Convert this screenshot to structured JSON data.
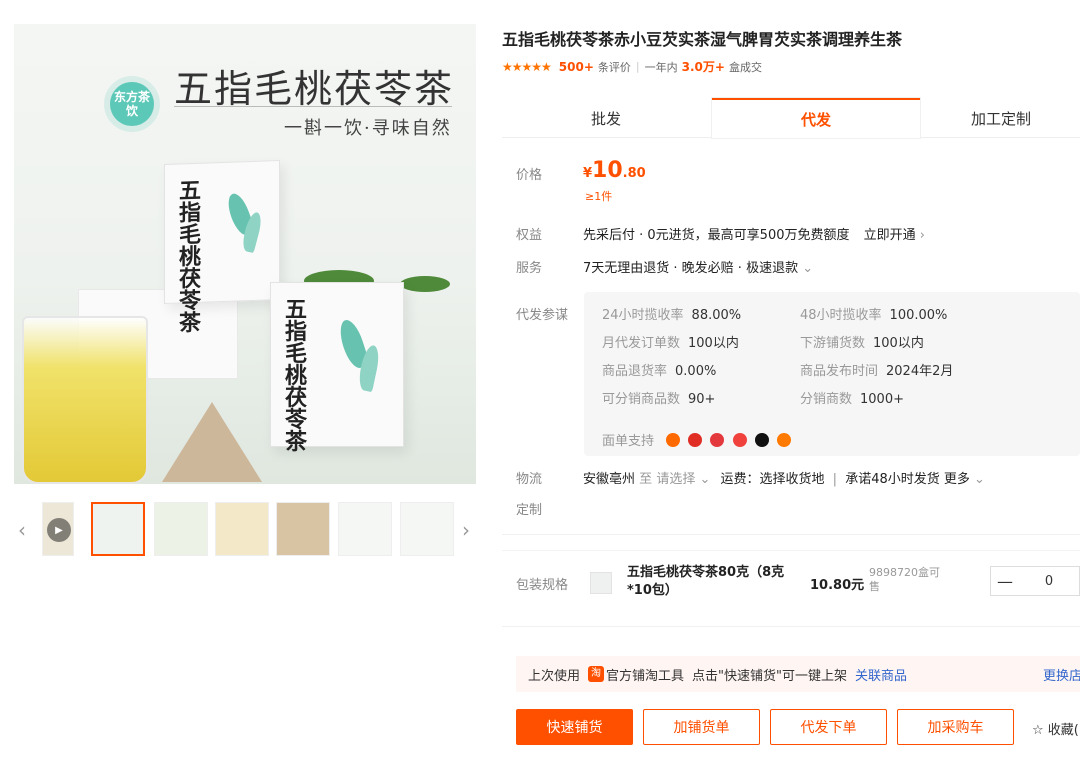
{
  "gallery": {
    "hero_title": "五指毛桃茯苓茶",
    "hero_subtitle": "一斟一饮·寻味自然",
    "logo_text": "东方茶饮",
    "box1_text": "五指毛桃茯苓茶",
    "box2_text": "五指毛桃茯苓茶",
    "prev_arrow": "‹",
    "next_arrow": "›"
  },
  "product": {
    "title": "五指毛桃茯苓茶赤小豆芡实茶湿气脾胃芡实茶调理养生茶",
    "stars": "★★★★★",
    "reviews_count": "500+",
    "reviews_label": "条评价",
    "sales_period": "一年内",
    "sales_count": "3.0万+",
    "sales_unit": "盒成交"
  },
  "tabs": [
    "批发",
    "代发",
    "加工定制"
  ],
  "price": {
    "label": "价格",
    "yen": "¥",
    "integer": "10",
    "decimal": ".80",
    "moq": "≥1件"
  },
  "rights": {
    "label": "权益",
    "text": "先采后付 · 0元进货，最高可享500万免费额度",
    "link": "立即开通"
  },
  "service": {
    "label": "服务",
    "text": "7天无理由退货 · 晚发必赔 · 极速退款"
  },
  "dropship": {
    "label": "代发参谋",
    "metrics": [
      {
        "k": "24小时揽收率",
        "v": "88.00%"
      },
      {
        "k": "48小时揽收率",
        "v": "100.00%"
      },
      {
        "k": "月代发订单数",
        "v": "100以内"
      },
      {
        "k": "下游铺货数",
        "v": "100以内"
      },
      {
        "k": "商品退货率",
        "v": "0.00%"
      },
      {
        "k": "商品发布时间",
        "v": "2024年2月"
      },
      {
        "k": "可分销商品数",
        "v": "90+"
      },
      {
        "k": "分销商数",
        "v": "1000+"
      }
    ],
    "support_label": "面单支持"
  },
  "logistics": {
    "label": "物流",
    "origin": "安徽亳州",
    "to": "至",
    "select_text": "请选择",
    "fee_text": "运费：选择收货地",
    "promise": "承诺48小时发货",
    "more": "更多"
  },
  "custom": {
    "label": "定制"
  },
  "package": {
    "label": "包装规格",
    "name": "五指毛桃茯苓茶80克（8克*10包）",
    "price": "10.80元",
    "stock": "9898720盒可售",
    "minus": "—",
    "quantity": "0"
  },
  "toolbar": {
    "prefix": "上次使用",
    "tool_icon": "淘",
    "tool_name": "官方铺淘工具",
    "hint": "点击\"快速铺货\"可一键上架",
    "link": "关联商品",
    "switch": "更换店"
  },
  "actions": {
    "quick_distribute": "快速铺货",
    "add_to_list": "加铺货单",
    "dropship_order": "代发下单",
    "add_to_cart": "加采购车",
    "favorite": "收藏("
  },
  "colors": {
    "accent": "#ff5000",
    "star": "#ff7300",
    "mint": "#5cc8b8",
    "link": "#3366cc"
  }
}
